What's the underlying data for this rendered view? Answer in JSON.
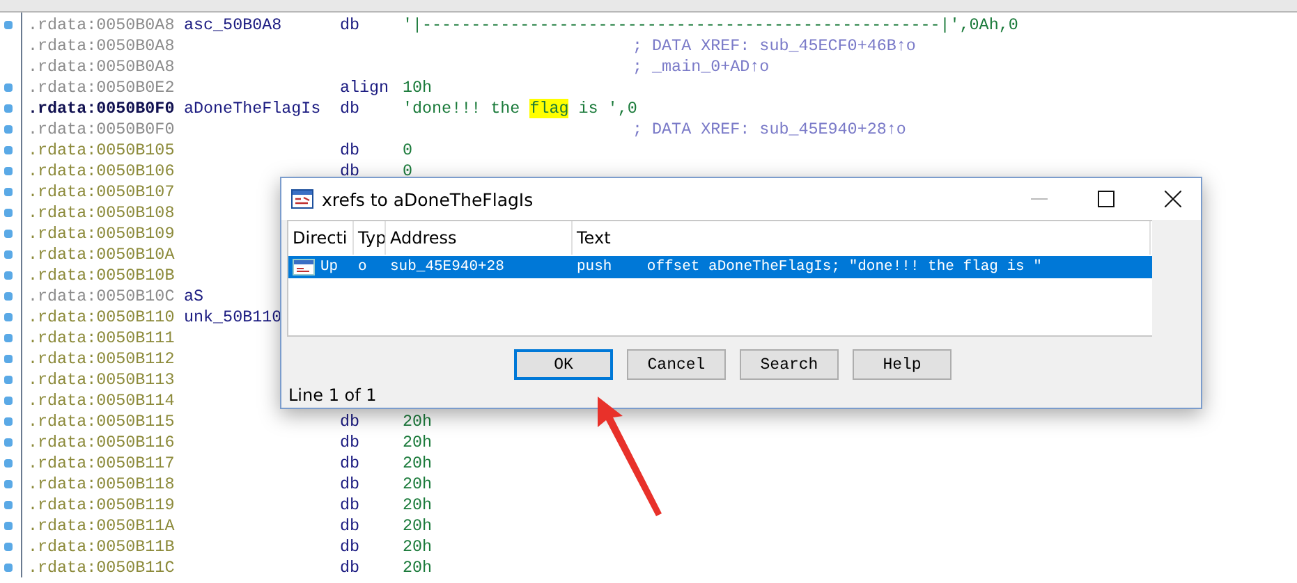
{
  "listing": [
    {
      "kind": "gray",
      "dot": true,
      "address": ".rdata:0050B0A8",
      "label": "asc_50B0A8",
      "mnemonic": "db",
      "operand": [
        {
          "text": "'|-----------------------------------------------------|',0Ah,0",
          "highlighted": false
        }
      ]
    },
    {
      "kind": "gray",
      "dot": false,
      "address": ".rdata:0050B0A8",
      "comment": "; DATA XREF: sub_45ECF0+46B↑o"
    },
    {
      "kind": "gray",
      "dot": false,
      "address": ".rdata:0050B0A8",
      "comment": "; _main_0+AD↑o"
    },
    {
      "kind": "gray",
      "dot": true,
      "address": ".rdata:0050B0E2",
      "mnemonic": "align",
      "operand": [
        {
          "text": "10h",
          "highlighted": false
        }
      ]
    },
    {
      "kind": "current",
      "dot": true,
      "address": ".rdata:0050B0F0",
      "label": "aDoneTheFlagIs",
      "mnemonic": "db",
      "operand": [
        {
          "text": "'done!!! the ",
          "highlighted": false
        },
        {
          "text": "flag",
          "highlighted": true
        },
        {
          "text": " is ',0",
          "highlighted": false
        }
      ]
    },
    {
      "kind": "gray",
      "dot": true,
      "address": ".rdata:0050B0F0",
      "comment": "; DATA XREF: sub_45E940+28↑o"
    },
    {
      "kind": "item",
      "dot": true,
      "address": ".rdata:0050B105",
      "mnemonic": "db",
      "operand": [
        {
          "text": "0",
          "highlighted": false
        }
      ]
    },
    {
      "kind": "item",
      "dot": true,
      "address": ".rdata:0050B106",
      "mnemonic": "db",
      "operand": [
        {
          "text": "0",
          "highlighted": false
        }
      ]
    },
    {
      "kind": "item",
      "dot": true,
      "address": ".rdata:0050B107"
    },
    {
      "kind": "item",
      "dot": true,
      "address": ".rdata:0050B108"
    },
    {
      "kind": "item",
      "dot": true,
      "address": ".rdata:0050B109"
    },
    {
      "kind": "item",
      "dot": true,
      "address": ".rdata:0050B10A"
    },
    {
      "kind": "item",
      "dot": true,
      "address": ".rdata:0050B10B"
    },
    {
      "kind": "gray",
      "dot": true,
      "address": ".rdata:0050B10C",
      "label": "aS"
    },
    {
      "kind": "item",
      "dot": true,
      "address": ".rdata:0050B110",
      "label": "unk_50B110"
    },
    {
      "kind": "item",
      "dot": true,
      "address": ".rdata:0050B111"
    },
    {
      "kind": "item",
      "dot": true,
      "address": ".rdata:0050B112"
    },
    {
      "kind": "item",
      "dot": true,
      "address": ".rdata:0050B113"
    },
    {
      "kind": "item",
      "dot": true,
      "address": ".rdata:0050B114"
    },
    {
      "kind": "item",
      "dot": true,
      "address": ".rdata:0050B115",
      "mnemonic": "db",
      "operand": [
        {
          "text": "20h",
          "highlighted": false
        }
      ]
    },
    {
      "kind": "item",
      "dot": true,
      "address": ".rdata:0050B116",
      "mnemonic": "db",
      "operand": [
        {
          "text": "20h",
          "highlighted": false
        }
      ]
    },
    {
      "kind": "item",
      "dot": true,
      "address": ".rdata:0050B117",
      "mnemonic": "db",
      "operand": [
        {
          "text": "20h",
          "highlighted": false
        }
      ]
    },
    {
      "kind": "item",
      "dot": true,
      "address": ".rdata:0050B118",
      "mnemonic": "db",
      "operand": [
        {
          "text": "20h",
          "highlighted": false
        }
      ]
    },
    {
      "kind": "item",
      "dot": true,
      "address": ".rdata:0050B119",
      "mnemonic": "db",
      "operand": [
        {
          "text": "20h",
          "highlighted": false
        }
      ]
    },
    {
      "kind": "item",
      "dot": true,
      "address": ".rdata:0050B11A",
      "mnemonic": "db",
      "operand": [
        {
          "text": "20h",
          "highlighted": false
        }
      ]
    },
    {
      "kind": "item",
      "dot": true,
      "address": ".rdata:0050B11B",
      "mnemonic": "db",
      "operand": [
        {
          "text": "20h",
          "highlighted": false
        }
      ]
    },
    {
      "kind": "item",
      "dot": true,
      "address": ".rdata:0050B11C",
      "mnemonic": "db",
      "operand": [
        {
          "text": "20h",
          "highlighted": false
        }
      ]
    }
  ],
  "dialog": {
    "title": "xrefs to aDoneTheFlagIs",
    "columns": [
      "Directi",
      "Typ",
      "Address",
      "Text"
    ],
    "rows": [
      {
        "selected": true,
        "direction": "Up",
        "type": "o",
        "address": "sub_45E940+28",
        "text": "push    offset aDoneTheFlagIs; \"done!!! the flag is \""
      }
    ],
    "buttons": [
      {
        "label": "OK",
        "focused": true
      },
      {
        "label": "Cancel",
        "focused": false
      },
      {
        "label": "Search",
        "focused": false
      },
      {
        "label": "Help",
        "focused": false
      }
    ],
    "status": "Line 1 of 1"
  }
}
